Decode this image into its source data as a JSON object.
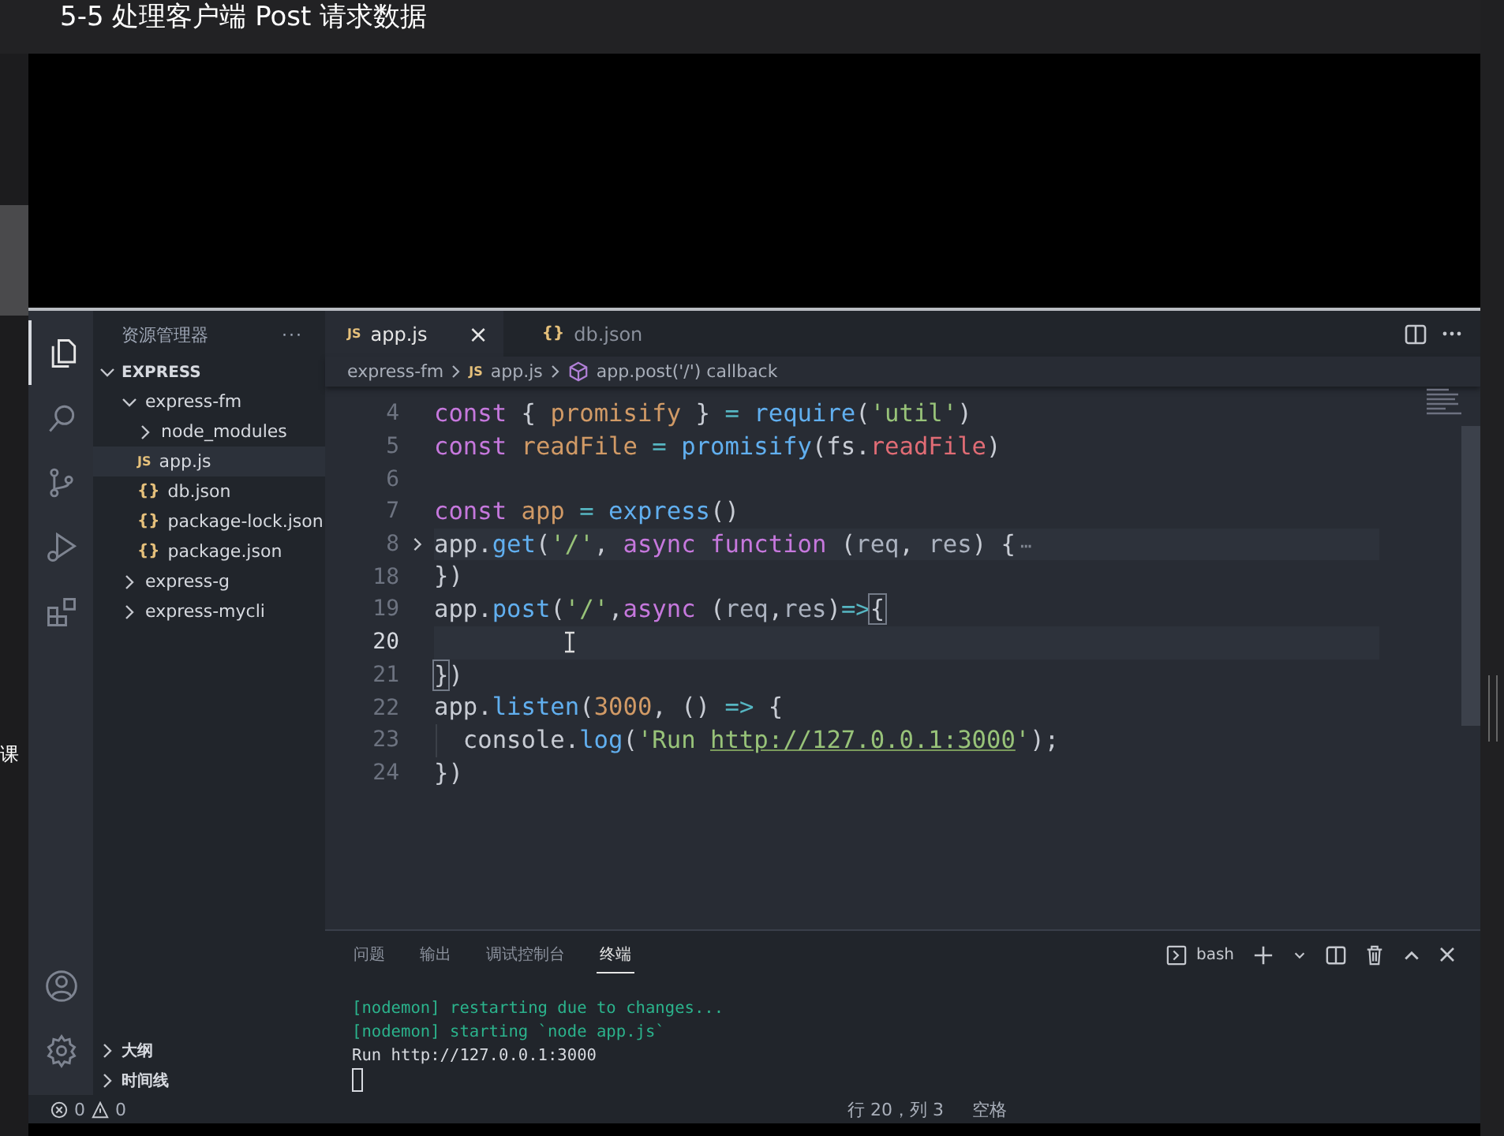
{
  "page_title": "5-5 处理客户端 Post 请求数据",
  "left_edge_text": "课",
  "activity_bar": [
    {
      "kind": "files",
      "selected": true
    },
    {
      "kind": "search",
      "selected": false
    },
    {
      "kind": "source-control",
      "selected": false
    },
    {
      "kind": "run",
      "selected": false
    },
    {
      "kind": "extensions",
      "selected": false
    }
  ],
  "activity_bottom": [
    {
      "kind": "account"
    },
    {
      "kind": "settings"
    }
  ],
  "sidebar": {
    "title": "资源管理器",
    "more": "···",
    "root": {
      "label": "EXPRESS",
      "expanded": true,
      "items": [
        {
          "label": "express-fm",
          "kind": "folder",
          "expanded": true,
          "selected": false,
          "children": [
            {
              "label": "node_modules",
              "kind": "folder",
              "expanded": false,
              "selected": false
            },
            {
              "label": "app.js",
              "kind": "js",
              "icon": "JS",
              "selected": true
            },
            {
              "label": "db.json",
              "kind": "json",
              "icon": "{}",
              "selected": false
            },
            {
              "label": "package-lock.json",
              "kind": "json",
              "icon": "{}",
              "selected": false
            },
            {
              "label": "package.json",
              "kind": "json",
              "icon": "{}",
              "selected": false
            }
          ]
        },
        {
          "label": "express-g",
          "kind": "folder",
          "expanded": false,
          "selected": false
        },
        {
          "label": "express-mycli",
          "kind": "folder",
          "expanded": false,
          "selected": false
        }
      ]
    },
    "bottom_sections": [
      {
        "label": "大纲",
        "expanded": false
      },
      {
        "label": "时间线",
        "expanded": false
      }
    ]
  },
  "tabs": [
    {
      "label": "app.js",
      "kind": "js",
      "icon": "JS",
      "selected": true,
      "close": "×"
    },
    {
      "label": "db.json",
      "kind": "json",
      "icon": "{}",
      "selected": false
    }
  ],
  "breadcrumb": [
    {
      "label": "express-fm",
      "kind": "folder"
    },
    {
      "label": "app.js",
      "kind": "js",
      "icon": "JS"
    },
    {
      "label": "app.post('/') callback",
      "kind": "symbol"
    }
  ],
  "code_lines": [
    {
      "number": "4",
      "tokens": [
        {
          "text": "const",
          "kind": "kw"
        },
        {
          "text": " { ",
          "kind": "plain"
        },
        {
          "text": "promisify",
          "kind": "var"
        },
        {
          "text": " } ",
          "kind": "plain"
        },
        {
          "text": "= ",
          "kind": "op"
        },
        {
          "text": "require",
          "kind": "fn"
        },
        {
          "text": "(",
          "kind": "plain"
        },
        {
          "text": "'util'",
          "kind": "str"
        },
        {
          "text": ")",
          "kind": "plain"
        }
      ]
    },
    {
      "number": "5",
      "tokens": [
        {
          "text": "const ",
          "kind": "kw"
        },
        {
          "text": "readFile ",
          "kind": "var"
        },
        {
          "text": "= ",
          "kind": "op"
        },
        {
          "text": "promisify",
          "kind": "fn"
        },
        {
          "text": "(fs.",
          "kind": "plain"
        },
        {
          "text": "readFile",
          "kind": "prop"
        },
        {
          "text": ")",
          "kind": "plain"
        }
      ]
    },
    {
      "number": "6"
    },
    {
      "number": "7",
      "tokens": [
        {
          "text": "const ",
          "kind": "kw"
        },
        {
          "text": "app ",
          "kind": "var"
        },
        {
          "text": "= ",
          "kind": "op"
        },
        {
          "text": "express",
          "kind": "fn"
        },
        {
          "text": "()",
          "kind": "plain"
        }
      ]
    },
    {
      "number": "8",
      "folded": true,
      "tokens": [
        {
          "text": "app.",
          "kind": "plain"
        },
        {
          "text": "get",
          "kind": "fn"
        },
        {
          "text": "(",
          "kind": "plain"
        },
        {
          "text": "'/'",
          "kind": "str"
        },
        {
          "text": ", ",
          "kind": "plain"
        },
        {
          "text": "async function",
          "kind": "kw"
        },
        {
          "text": " (",
          "kind": "plain"
        },
        {
          "text": "req",
          "kind": "param"
        },
        {
          "text": ", ",
          "kind": "plain"
        },
        {
          "text": "res",
          "kind": "param"
        },
        {
          "text": ") {",
          "kind": "plain"
        },
        {
          "text": "⋯",
          "kind": "fold"
        }
      ]
    },
    {
      "number": "18",
      "tokens": [
        {
          "text": "})",
          "kind": "plain"
        }
      ]
    },
    {
      "number": "19",
      "tokens": [
        {
          "text": "app.",
          "kind": "plain"
        },
        {
          "text": "post",
          "kind": "fn"
        },
        {
          "text": "(",
          "kind": "plain"
        },
        {
          "text": "'/'",
          "kind": "str"
        },
        {
          "text": ",",
          "kind": "plain"
        },
        {
          "text": "async",
          "kind": "kw"
        },
        {
          "text": " (",
          "kind": "plain"
        },
        {
          "text": "req",
          "kind": "param"
        },
        {
          "text": ",",
          "kind": "plain"
        },
        {
          "text": "res",
          "kind": "param"
        },
        {
          "text": ")",
          "kind": "plain"
        },
        {
          "text": "=>",
          "kind": "op"
        },
        {
          "text": "{",
          "kind": "match"
        }
      ]
    },
    {
      "number": "20",
      "current": true
    },
    {
      "number": "21",
      "tokens": [
        {
          "text": "}",
          "kind": "match"
        },
        {
          "text": ")",
          "kind": "plain"
        }
      ]
    },
    {
      "number": "22",
      "tokens": [
        {
          "text": "app.",
          "kind": "plain"
        },
        {
          "text": "listen",
          "kind": "fn"
        },
        {
          "text": "(",
          "kind": "plain"
        },
        {
          "text": "3000",
          "kind": "num"
        },
        {
          "text": ", () ",
          "kind": "plain"
        },
        {
          "text": "=>",
          "kind": "op"
        },
        {
          "text": " {",
          "kind": "plain"
        }
      ]
    },
    {
      "number": "23",
      "indented": true,
      "tokens": [
        {
          "text": "console.",
          "kind": "plain"
        },
        {
          "text": "log",
          "kind": "fn"
        },
        {
          "text": "(",
          "kind": "plain"
        },
        {
          "text": "'Run ",
          "kind": "str"
        },
        {
          "text": "http://127.0.0.1:3000",
          "kind": "link"
        },
        {
          "text": "'",
          "kind": "str"
        },
        {
          "text": ");",
          "kind": "plain"
        }
      ]
    },
    {
      "number": "24",
      "tokens": [
        {
          "text": "})",
          "kind": "plain"
        }
      ]
    }
  ],
  "panel": {
    "tabs": [
      {
        "label": "问题",
        "selected": false
      },
      {
        "label": "输出",
        "selected": false
      },
      {
        "label": "调试控制台",
        "selected": false
      },
      {
        "label": "终端",
        "selected": true
      }
    ],
    "shell": "bash",
    "terminal_lines": [
      {
        "text": "[nodemon] restarting due to changes...",
        "kind": "nodemon"
      },
      {
        "text": "[nodemon] starting `node app.js`",
        "kind": "nodemon"
      },
      {
        "text": "Run http://127.0.0.1:3000",
        "kind": "plain"
      }
    ]
  },
  "status_bar": {
    "errors": "0",
    "warnings": "0",
    "position": "行 20，列 3",
    "indent": "空格"
  }
}
